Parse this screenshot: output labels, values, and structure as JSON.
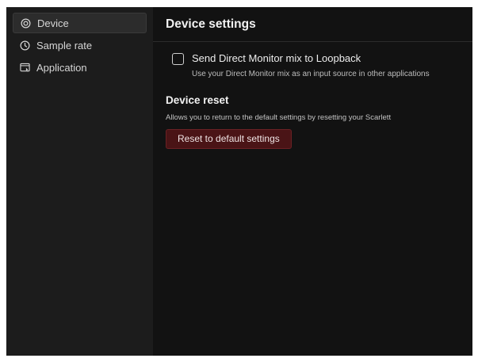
{
  "sidebar": {
    "items": [
      {
        "label": "Device",
        "icon": "device-icon",
        "active": true
      },
      {
        "label": "Sample rate",
        "icon": "clock-icon",
        "active": false
      },
      {
        "label": "Application",
        "icon": "application-icon",
        "active": false
      }
    ]
  },
  "main": {
    "title": "Device settings",
    "loopback": {
      "label": "Send Direct Monitor mix to Loopback",
      "description": "Use your Direct Monitor mix as an input source in other applications",
      "checked": false
    },
    "reset": {
      "title": "Device reset",
      "description": "Allows you to return to the default settings by resetting your Scarlett",
      "button_label": "Reset to default settings"
    }
  },
  "colors": {
    "sidebar_bg": "#1c1c1c",
    "main_bg": "#121212",
    "reset_button_bg": "#4a1416",
    "reset_button_border": "#6b2124"
  }
}
